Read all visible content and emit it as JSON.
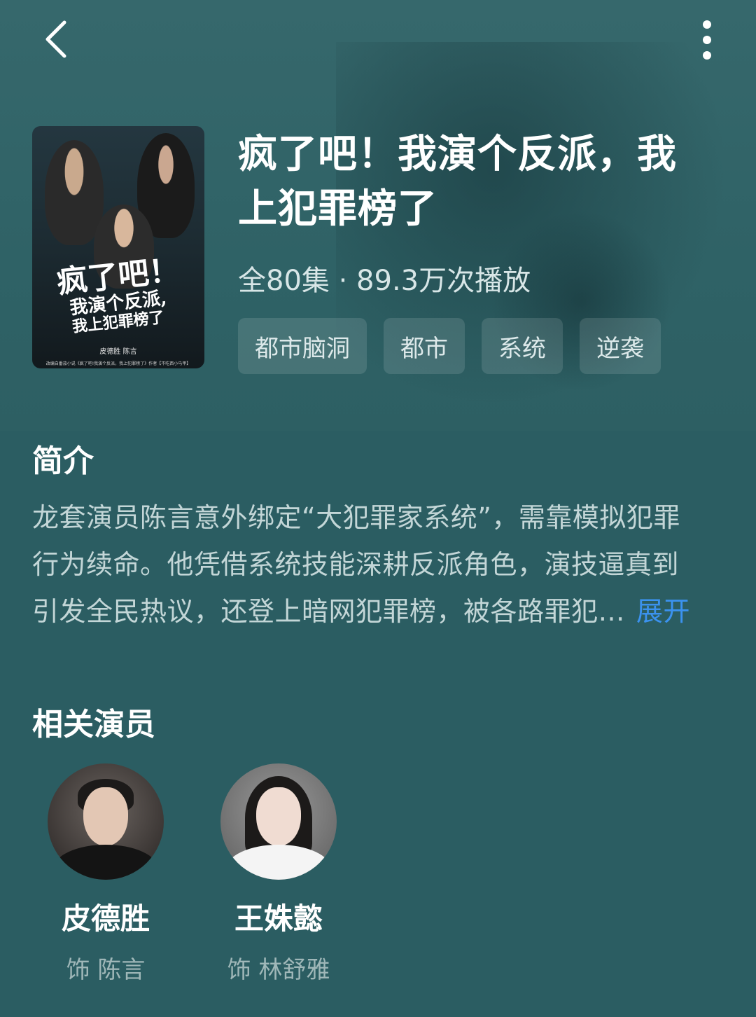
{
  "header": {
    "back_icon": "chevron-left-icon",
    "more_icon": "more-vertical-icon"
  },
  "drama": {
    "poster": {
      "title_line1": "疯了吧！",
      "title_line2": "我演个反派,",
      "title_line3": "我上犯罪榜了",
      "credit": "皮德胜   陈言",
      "footer": "改编自番茄小说《疯了吧!我演个反派，我上犯罪榜了》作者【不吃西小马甲】"
    },
    "title": "疯了吧！我演个反派，我上犯罪榜了",
    "stats": "全80集 · 89.3万次播放",
    "tags": [
      "都市脑洞",
      "都市",
      "系统",
      "逆袭"
    ]
  },
  "intro": {
    "heading": "简介",
    "line1": "龙套演员陈言意外绑定“大犯罪家系统”，需靠模拟犯罪",
    "line2": "行为续命。他凭借系统技能深耕反派角色，演技逼真到",
    "line3": "引发全民热议，还登上暗网犯罪榜，被各路罪犯…",
    "expand_label": "展开"
  },
  "cast": {
    "heading": "相关演员",
    "actors": [
      {
        "name": "皮德胜",
        "role": "饰 陈言"
      },
      {
        "name": "王姝懿",
        "role": "饰 林舒雅"
      }
    ]
  },
  "colors": {
    "background": "#2b5d62",
    "accent_link": "#3b92ef"
  }
}
